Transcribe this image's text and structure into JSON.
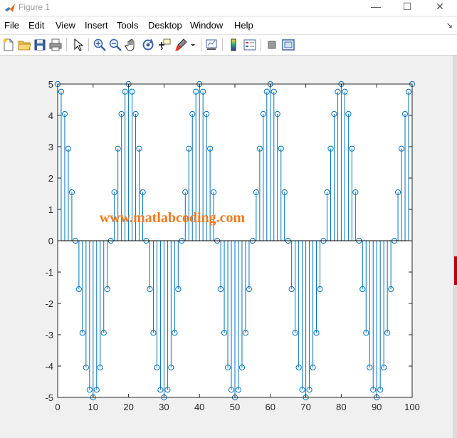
{
  "window": {
    "title": "Figure 1",
    "minimize": "—",
    "maximize": "☐",
    "close": "✕"
  },
  "menu": [
    "File",
    "Edit",
    "View",
    "Insert",
    "Tools",
    "Desktop",
    "Window",
    "Help"
  ],
  "menu_arrow": "↘",
  "toolbar": [
    "new-figure",
    "open-file",
    "save",
    "print",
    "edit-plot",
    "zoom-in",
    "zoom-out",
    "pan",
    "rotate-3d",
    "data-cursor",
    "brush",
    "link-plot",
    "colorbar",
    "legend",
    "hide-plot-tools",
    "show-plot-tools"
  ],
  "watermark": "www.matlabcoding.com",
  "colors": {
    "stem": "#0072bd",
    "watermark": "#f07b1e",
    "axes_bg": "#ffffff"
  },
  "chart_data": {
    "type": "stem",
    "formula_note": "",
    "x_start": 0,
    "x_end": 100,
    "values": [
      5.0,
      4.755,
      4.045,
      2.939,
      1.545,
      0.0,
      -1.545,
      -2.939,
      -4.045,
      -4.755,
      -5.0,
      -4.755,
      -4.045,
      -2.939,
      -1.545,
      0.0,
      1.545,
      2.939,
      4.045,
      4.755,
      5.0,
      4.755,
      4.045,
      2.939,
      1.545,
      0.0,
      -1.545,
      -2.939,
      -4.045,
      -4.755,
      -5.0,
      -4.755,
      -4.045,
      -2.939,
      -1.545,
      0.0,
      1.545,
      2.939,
      4.045,
      4.755,
      5.0,
      4.755,
      4.045,
      2.939,
      1.545,
      0.0,
      -1.545,
      -2.939,
      -4.045,
      -4.755,
      -5.0,
      -4.755,
      -4.045,
      -2.939,
      -1.545,
      0.0,
      1.545,
      2.939,
      4.045,
      4.755,
      5.0,
      4.755,
      4.045,
      2.939,
      1.545,
      0.0,
      -1.545,
      -2.939,
      -4.045,
      -4.755,
      -5.0,
      -4.755,
      -4.045,
      -2.939,
      -1.545,
      0.0,
      1.545,
      2.939,
      4.045,
      4.755,
      5.0,
      4.755,
      4.045,
      2.939,
      1.545,
      0.0,
      -1.545,
      -2.939,
      -4.045,
      -4.755,
      -5.0,
      -4.755,
      -4.045,
      -2.939,
      -1.545,
      0.0,
      1.545,
      2.939,
      4.045,
      4.755,
      5.0
    ],
    "xlim": [
      0,
      100
    ],
    "ylim": [
      -5,
      5
    ],
    "xticks": [
      "0",
      "10",
      "20",
      "30",
      "40",
      "50",
      "60",
      "70",
      "80",
      "90",
      "100"
    ],
    "yticks": [
      "5",
      "4",
      "3",
      "2",
      "1",
      "0",
      "-1",
      "-2",
      "-3",
      "-4",
      "-5"
    ],
    "title": "",
    "xlabel": "",
    "ylabel": "",
    "grid": false,
    "legend": "none"
  }
}
